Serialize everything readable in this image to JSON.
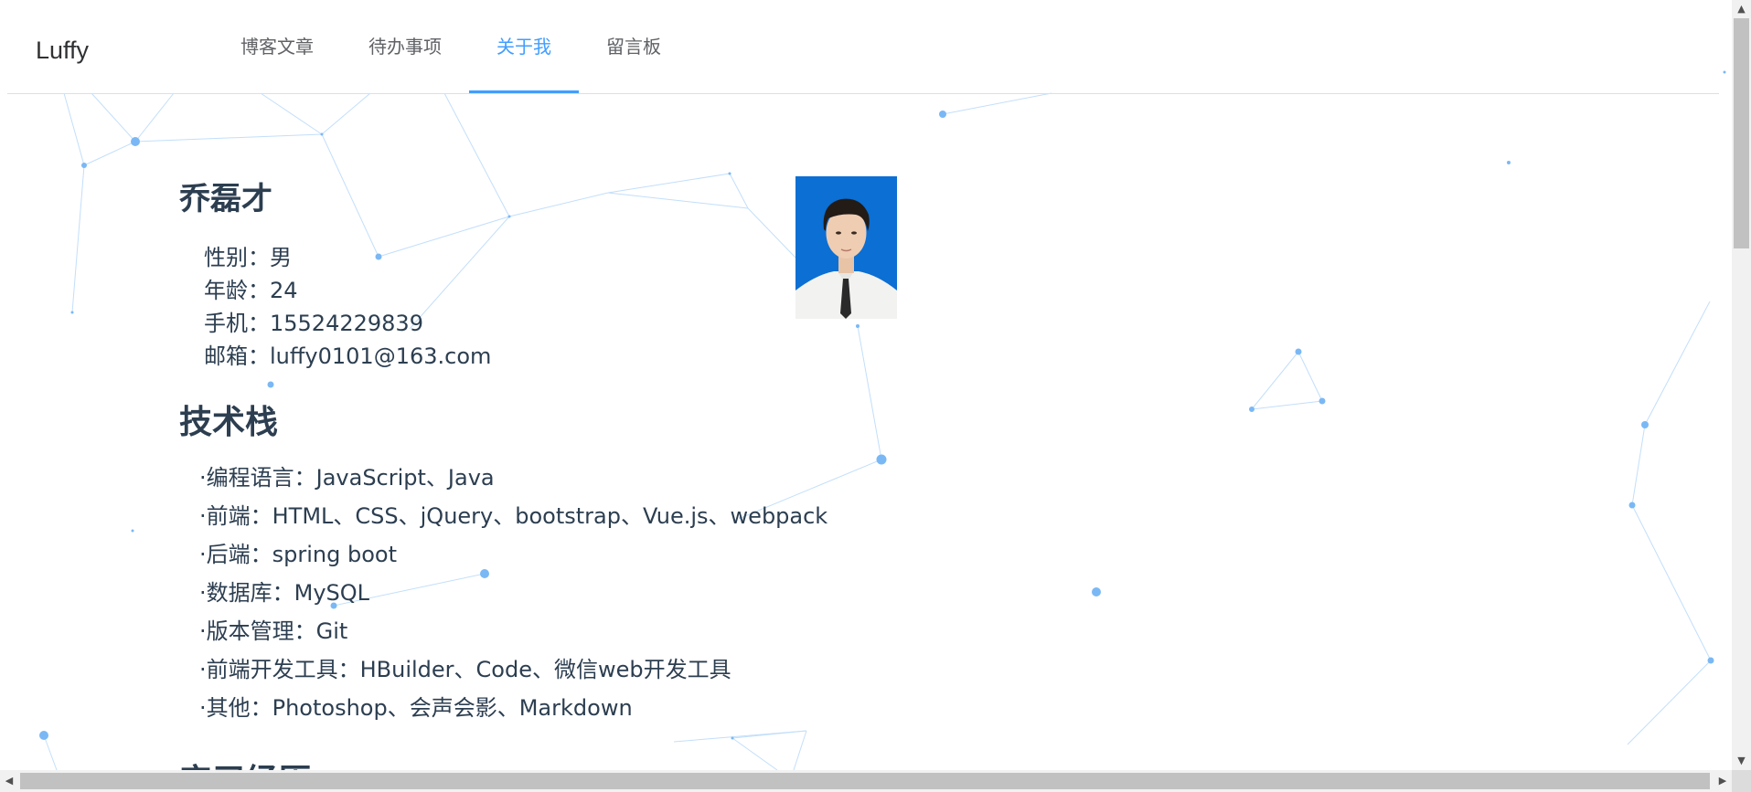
{
  "header": {
    "brand": "Luffy",
    "nav": [
      {
        "label": "博客文章",
        "active": false
      },
      {
        "label": "待办事项",
        "active": false
      },
      {
        "label": "关于我",
        "active": true
      },
      {
        "label": "留言板",
        "active": false
      }
    ]
  },
  "profile": {
    "name": "乔磊才",
    "info": [
      {
        "label": "性别：",
        "value": "男"
      },
      {
        "label": "年龄：",
        "value": "24"
      },
      {
        "label": "手机：",
        "value": "15524229839"
      },
      {
        "label": "邮箱：",
        "value": "luffy0101@163.com"
      }
    ]
  },
  "tech_stack": {
    "title": "技术栈",
    "items": [
      "·编程语言：JavaScript、Java",
      "·前端：HTML、CSS、jQuery、bootstrap、Vue.js、webpack",
      "·后端：spring boot",
      "·数据库：MySQL",
      "·版本管理：Git",
      "·前端开发工具：HBuilder、Code、微信web开发工具",
      "·其他：Photoshop、会声会影、Markdown"
    ]
  },
  "next_section": {
    "title": "实习经历"
  },
  "colors": {
    "accent": "#409eff",
    "text": "#2c3e50",
    "nav_text": "#606266",
    "particle": "#7ab8f5"
  },
  "icons": {
    "scroll_up": "triangle-up-icon",
    "scroll_down": "triangle-down-icon",
    "scroll_left": "triangle-left-icon",
    "scroll_right": "triangle-right-icon"
  }
}
